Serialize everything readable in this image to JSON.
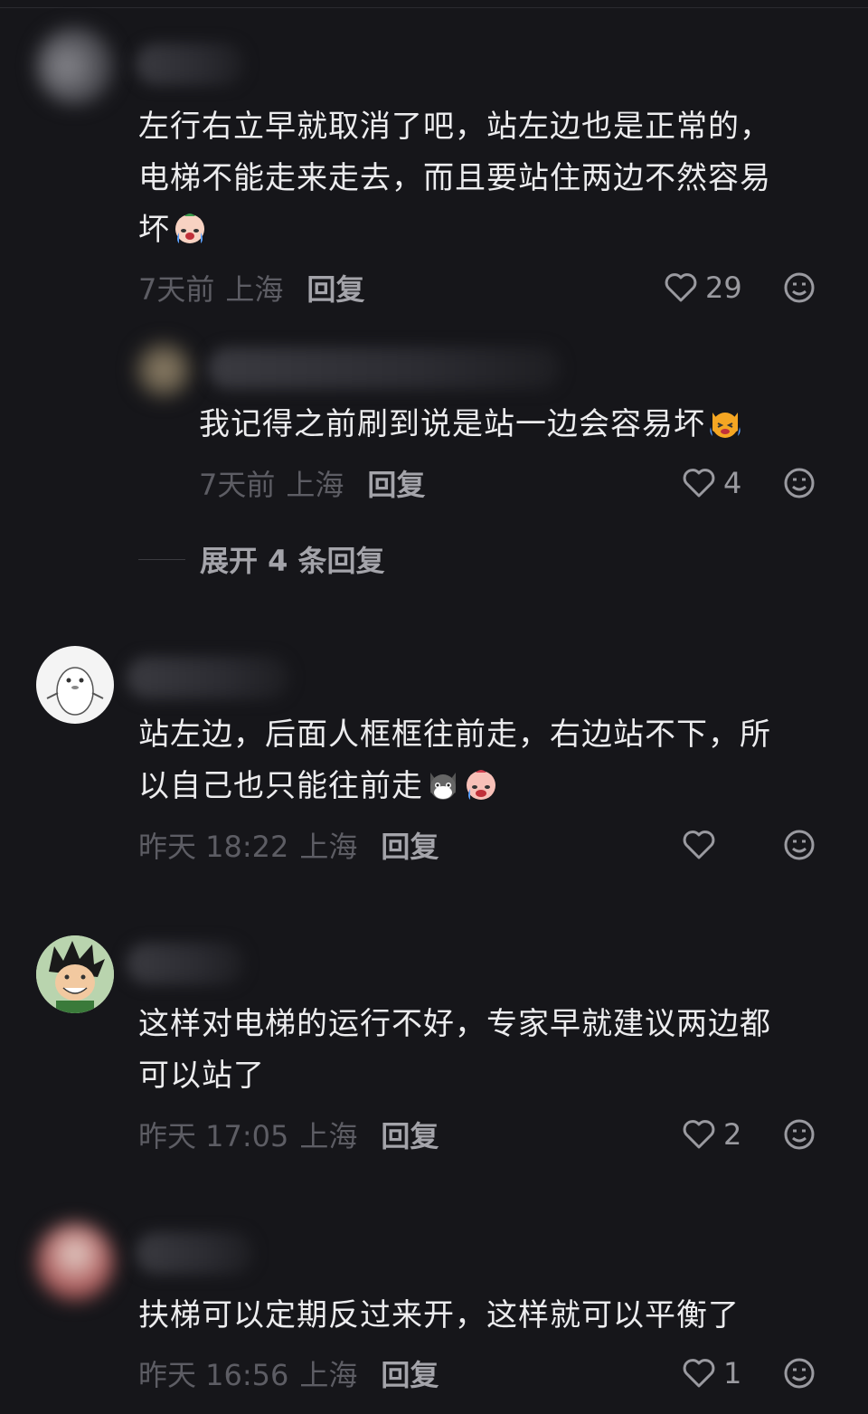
{
  "comments": [
    {
      "text_lines": [
        "左行右立早就取消了吧，站左边也是正常的，",
        "电梯不能走来走去，而且要站住两边不然容易",
        "坏"
      ],
      "emoji": [
        "crying-baby-emoji"
      ],
      "time": "7天前",
      "location": "上海",
      "reply_label": "回复",
      "likes": "29"
    },
    {
      "text": "我记得之前刷到说是站一边会容易坏",
      "emoji": [
        "crying-cat-emoji"
      ],
      "time": "7天前",
      "location": "上海",
      "reply_label": "回复",
      "likes": "4"
    },
    {
      "text_lines": [
        "站左边，后面人框框往前走，右边站不下，所",
        "以自己也只能往前走"
      ],
      "emoji": [
        "cat-face-emoji",
        "crying-baby-emoji"
      ],
      "time": "昨天 18:22",
      "location": "上海",
      "reply_label": "回复",
      "likes": ""
    },
    {
      "text_lines": [
        "这样对电梯的运行不好，专家早就建议两边都",
        "可以站了"
      ],
      "time": "昨天 17:05",
      "location": "上海",
      "reply_label": "回复",
      "likes": "2"
    },
    {
      "text": "扶梯可以定期反过来开，这样就可以平衡了",
      "time": "昨天 16:56",
      "location": "上海",
      "reply_label": "回复",
      "likes": "1"
    }
  ],
  "expand_replies": "展开 4 条回复",
  "colors": {
    "background": "#16161a",
    "text": "#ececee",
    "meta": "#5d5d64",
    "reply": "#a4a4aa"
  },
  "icons": {
    "like": "heart-outline-icon",
    "react": "smiley-face-icon"
  }
}
